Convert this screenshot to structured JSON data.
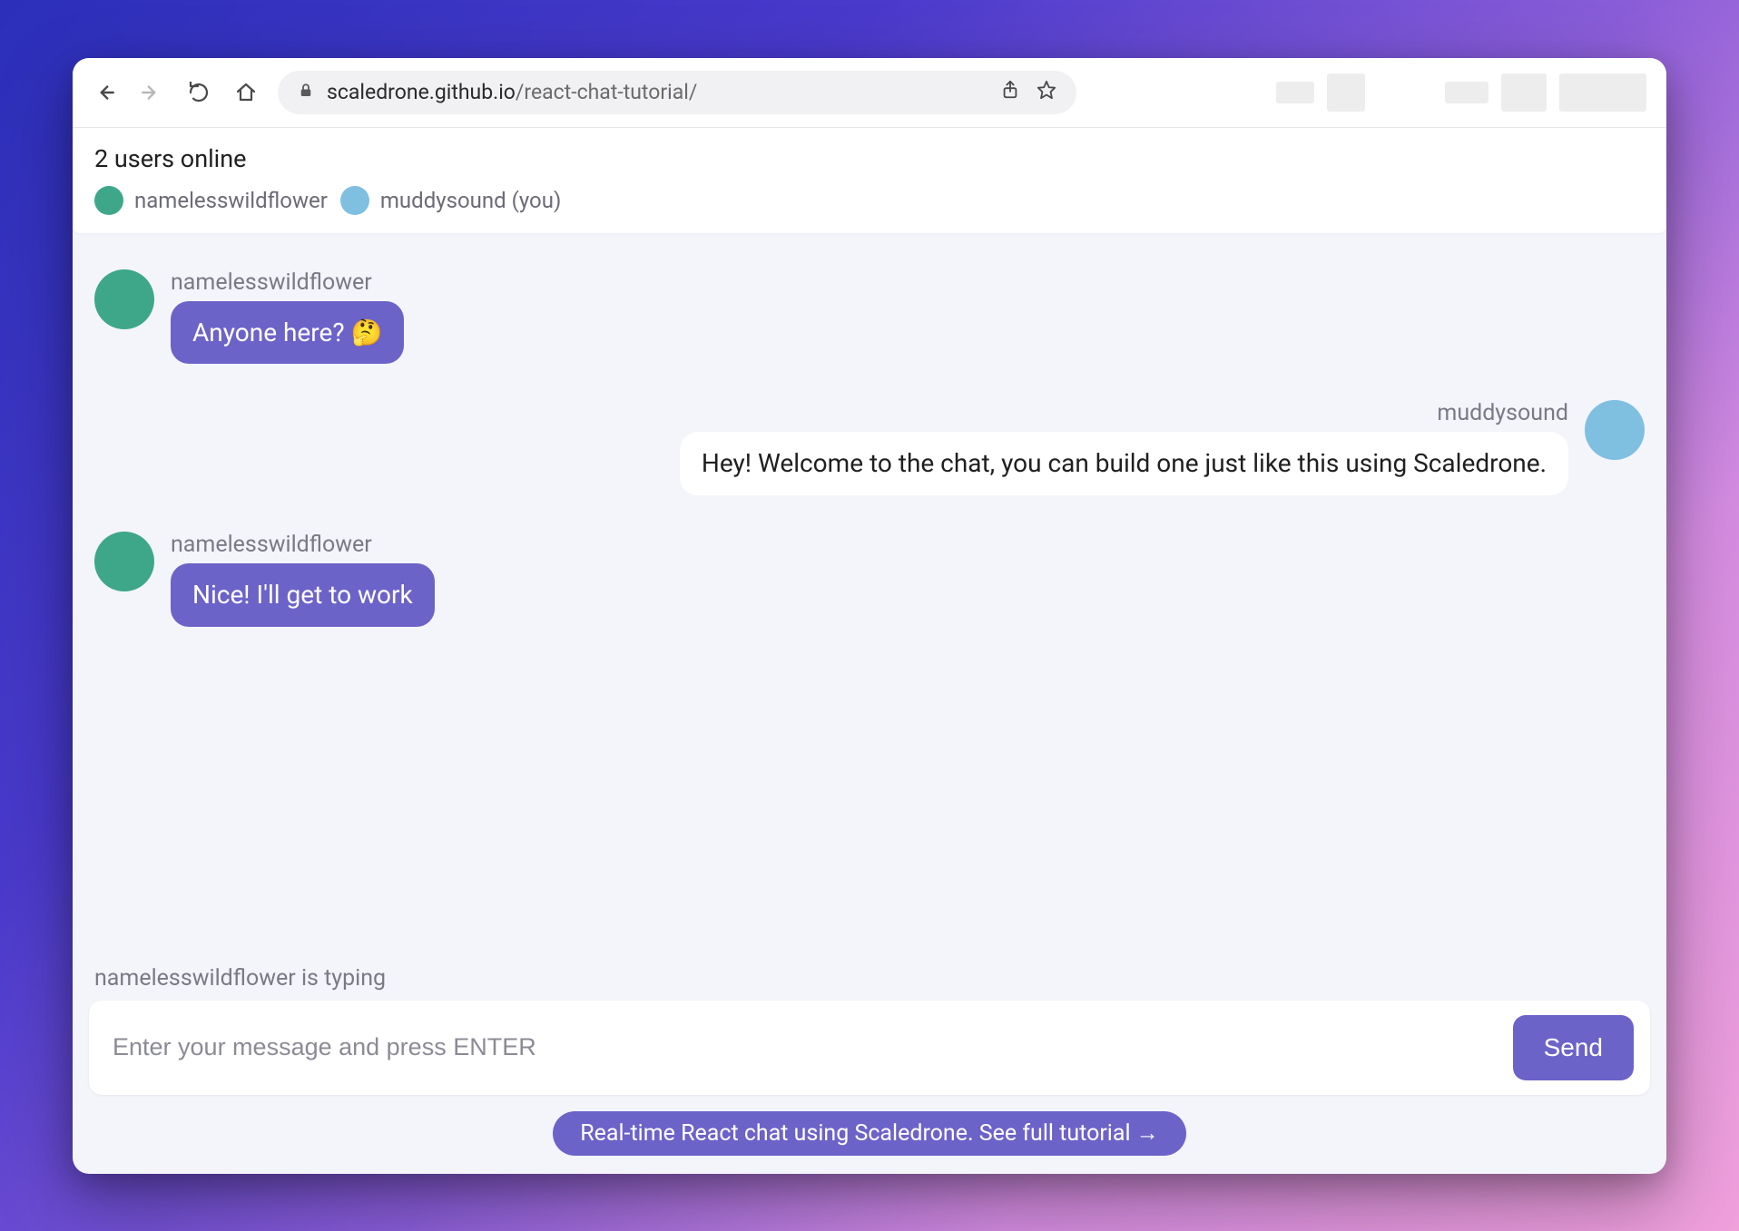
{
  "browser": {
    "url_domain": "scaledrone.github.io",
    "url_path": "/react-chat-tutorial/"
  },
  "online": {
    "title": "2 users online",
    "users": [
      {
        "name": "namelesswildflower",
        "color": "c-green"
      },
      {
        "name": "muddysound (you)",
        "color": "c-blue"
      }
    ]
  },
  "messages": [
    {
      "author": "namelesswildflower",
      "text": "Anyone here? 🤔",
      "mine": false,
      "color": "c-green"
    },
    {
      "author": "muddysound",
      "text": "Hey! Welcome to the chat, you can build one just like this using Scaledrone.",
      "mine": true,
      "color": "c-blue"
    },
    {
      "author": "namelesswildflower",
      "text": "Nice! I'll get to work",
      "mine": false,
      "color": "c-green"
    }
  ],
  "typing": "namelesswildflower is typing",
  "compose": {
    "placeholder": "Enter your message and press ENTER",
    "send_label": "Send"
  },
  "footer": {
    "link_text": "Real-time React chat using Scaledrone. See full tutorial →"
  }
}
